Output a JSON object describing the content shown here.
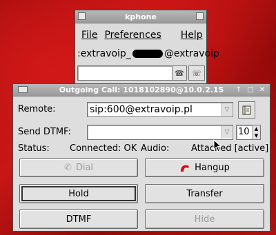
{
  "kphone": {
    "title": "kphone",
    "menu": {
      "file": "File",
      "preferences": "Preferences",
      "help": "Help"
    },
    "identity": ":extravoip_",
    "identity_suffix": "@extravoip"
  },
  "dialog": {
    "title": "Outgoing Call: 1018102890@10.0.2.15",
    "remote_label": "Remote:",
    "remote_value": "sip:600@extravoip.pl",
    "dtmf_label": "Send DTMF:",
    "dtmf_value": "",
    "dtmf_duration": "10",
    "status_label": "Status:",
    "status_value": "Connected: OK",
    "audio_label": "Audio:",
    "audio_value": "Attached [active]",
    "buttons": {
      "dial": "Dial",
      "hangup": "Hangup",
      "hold": "Hold",
      "transfer": "Transfer",
      "dtmf": "DTMF",
      "hide": "Hide"
    }
  },
  "colors": {
    "desktop": "#b81212",
    "hangup_icon": "#d01010",
    "window_bg": "#dcdcdc"
  }
}
